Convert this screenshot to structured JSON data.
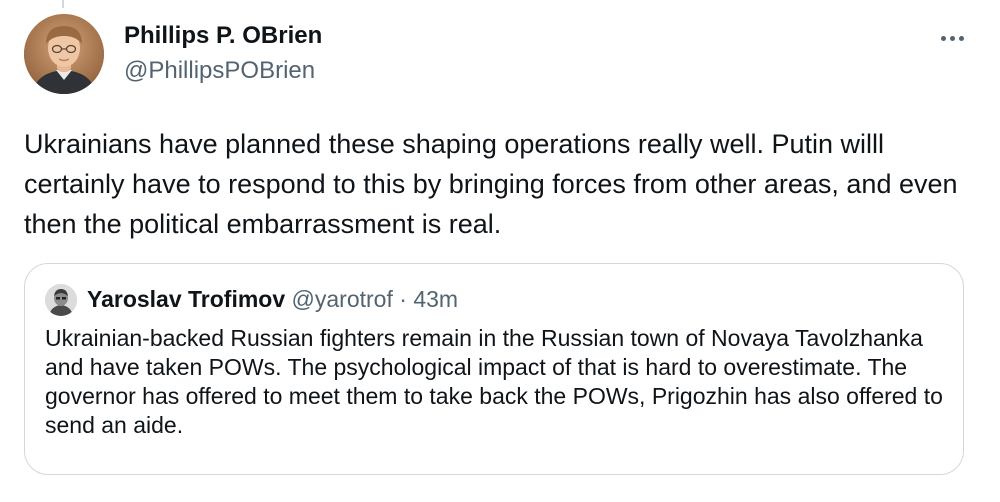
{
  "tweet": {
    "author": {
      "name": "Phillips P. OBrien",
      "handle": "@PhillipsPOBrien"
    },
    "text": "Ukrainians have planned these shaping operations really well. Putin willl certainly have to respond to this by bringing forces from other areas, and even then the political embarrassment is real.",
    "more_icon": "more-horizontal-icon"
  },
  "quoted_tweet": {
    "author": {
      "name": "Yaroslav Trofimov",
      "handle": "@yarotrof"
    },
    "separator": " · ",
    "time": "43m",
    "text": "Ukrainian-backed Russian fighters remain in the Russian town of Novaya Tavolzhanka and have taken POWs. The psychological impact of that is hard to overestimate. The governor has offered to meet them to take back the POWs, Prigozhin has also offered to send an aide."
  },
  "colors": {
    "text_primary": "#0f1419",
    "text_secondary": "#536471",
    "border": "#cfd9de"
  }
}
